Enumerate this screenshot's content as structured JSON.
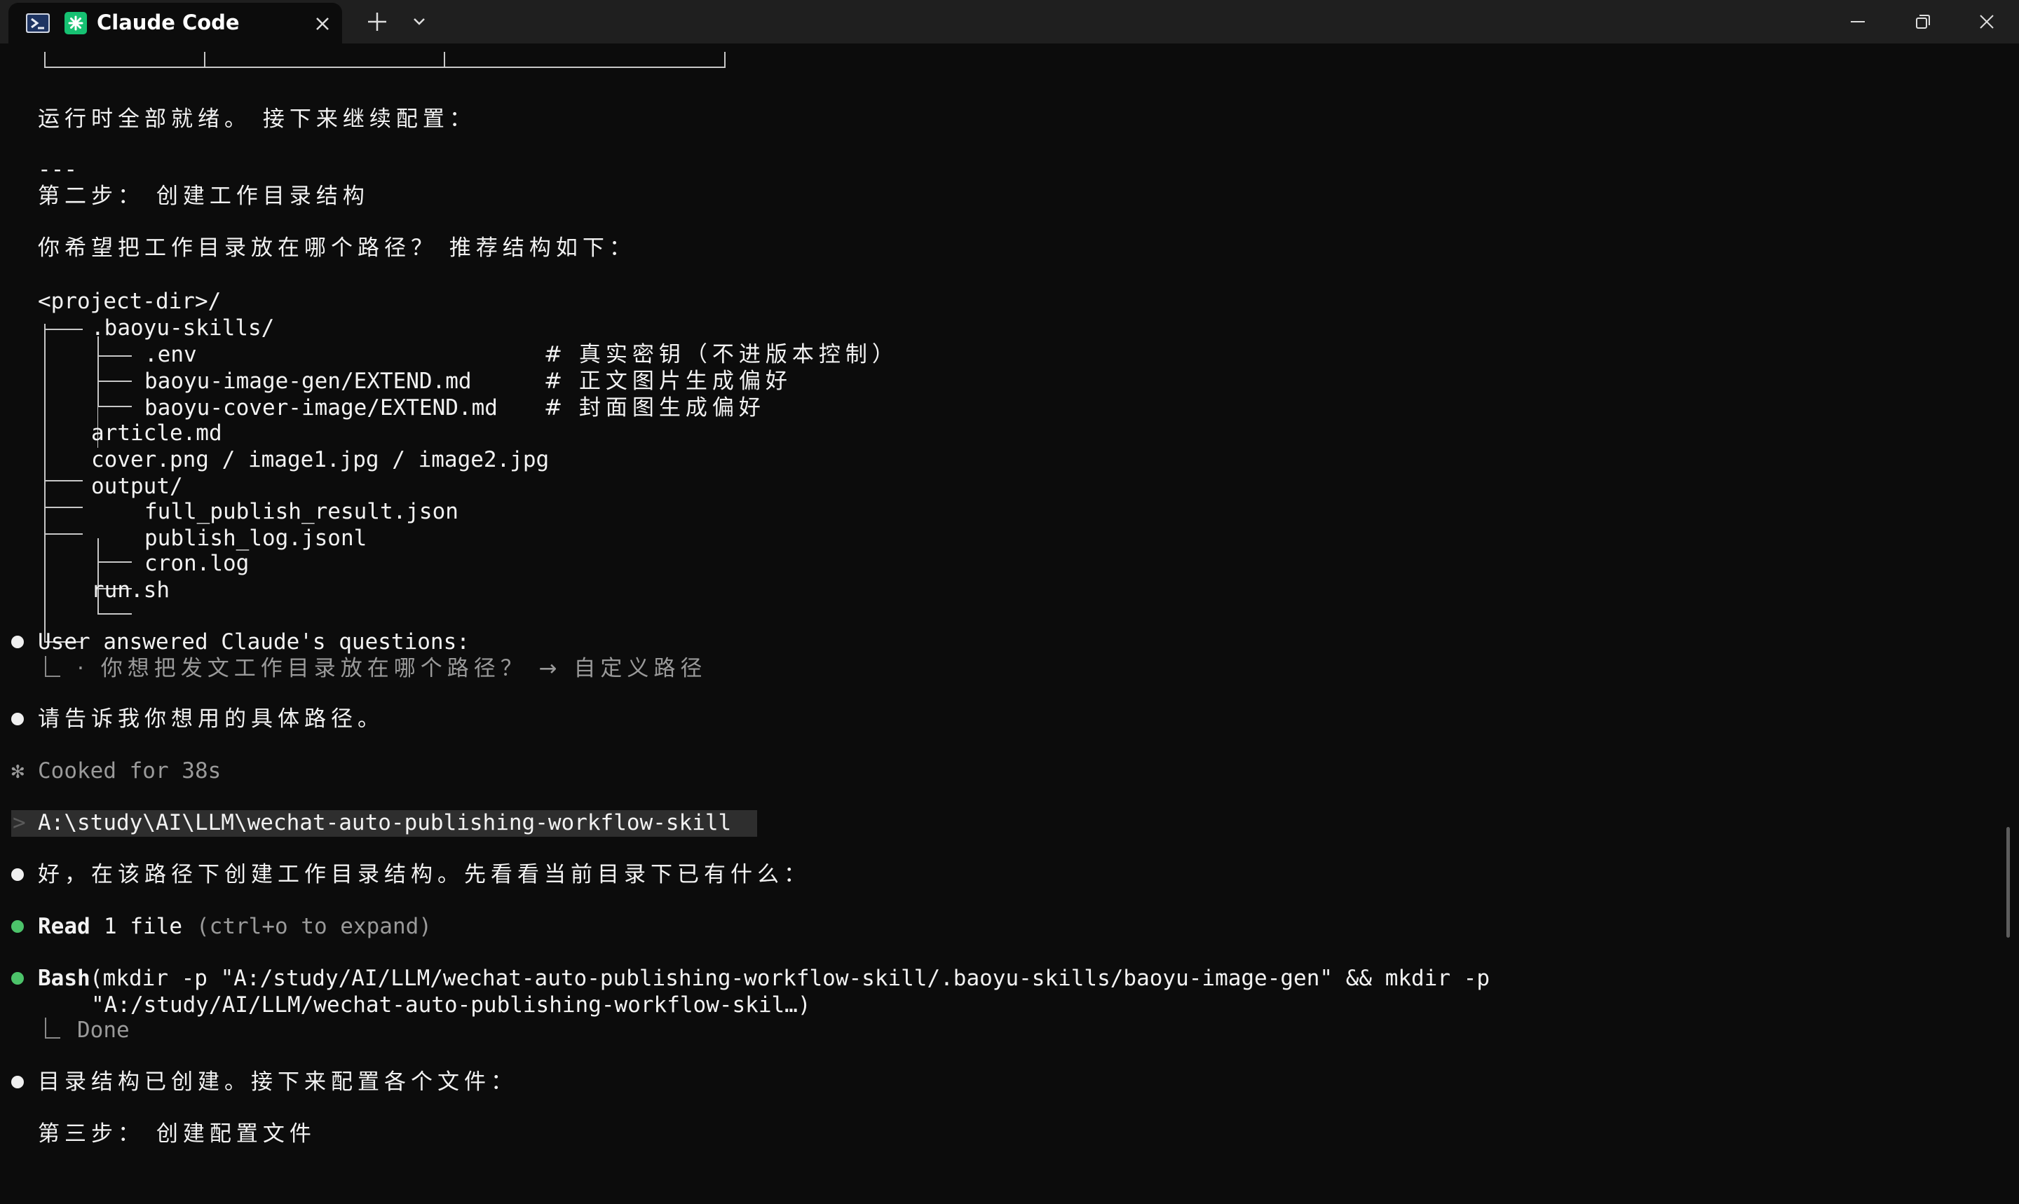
{
  "window": {
    "tab_title": "Claude Code",
    "shell_icon": "powershell-icon",
    "app_icon": "claude-code-icon",
    "accent": "#16c172"
  },
  "terminal": {
    "status_intro": "运行时全部就绪。 接下来继续配置：",
    "separator": "---",
    "step2_title": "第二步： 创建工作目录结构",
    "step2_question": "你希望把工作目录放在哪个路径？ 推荐结构如下：",
    "tree": {
      "root": "<project-dir>/",
      "baoyu_dir": ".baoyu-skills/",
      "env_file": ".env",
      "env_comment": "# 真实密钥（不进版本控制）",
      "image_gen_file": "baoyu-image-gen/EXTEND.md",
      "image_gen_comment": "# 正文图片生成偏好",
      "cover_image_file": "baoyu-cover-image/EXTEND.md",
      "cover_image_comment": "# 封面图生成偏好",
      "article_file": "article.md",
      "images_line": "cover.png / image1.jpg / image2.jpg",
      "output_dir": "output/",
      "result_file": "full_publish_result.json",
      "log_file": "publish_log.jsonl",
      "cron_file": "cron.log",
      "run_file": "run.sh"
    },
    "answered_header": "User answered Claude's questions:",
    "answered_detail": "· 你想把发文工作目录放在哪个路径？ → 自定义路径",
    "ask_path": "请告诉我你想用的具体路径。",
    "cooked": "Cooked for 38s",
    "prompt_caret": ">",
    "prompt_text": "A:\\study\\AI\\LLM\\wechat-auto-publishing-workflow-skill",
    "create_msg": "好，在该路径下创建工作目录结构。先看看当前目录下已有什么：",
    "read_tool": "Read",
    "read_detail": "1 file",
    "read_hint": "(ctrl+o to expand)",
    "bash_tool": "Bash",
    "bash_cmd_line1": "(mkdir -p \"A:/study/AI/LLM/wechat-auto-publishing-workflow-skill/.baoyu-skills/baoyu-image-gen\" && mkdir -p",
    "bash_cmd_line2": "\"A:/study/AI/LLM/wechat-auto-publishing-workflow-skil…)",
    "bash_result": "Done",
    "created_msg": "目录结构已创建。接下来配置各个文件：",
    "step3_title": "第三步： 创建配置文件"
  }
}
